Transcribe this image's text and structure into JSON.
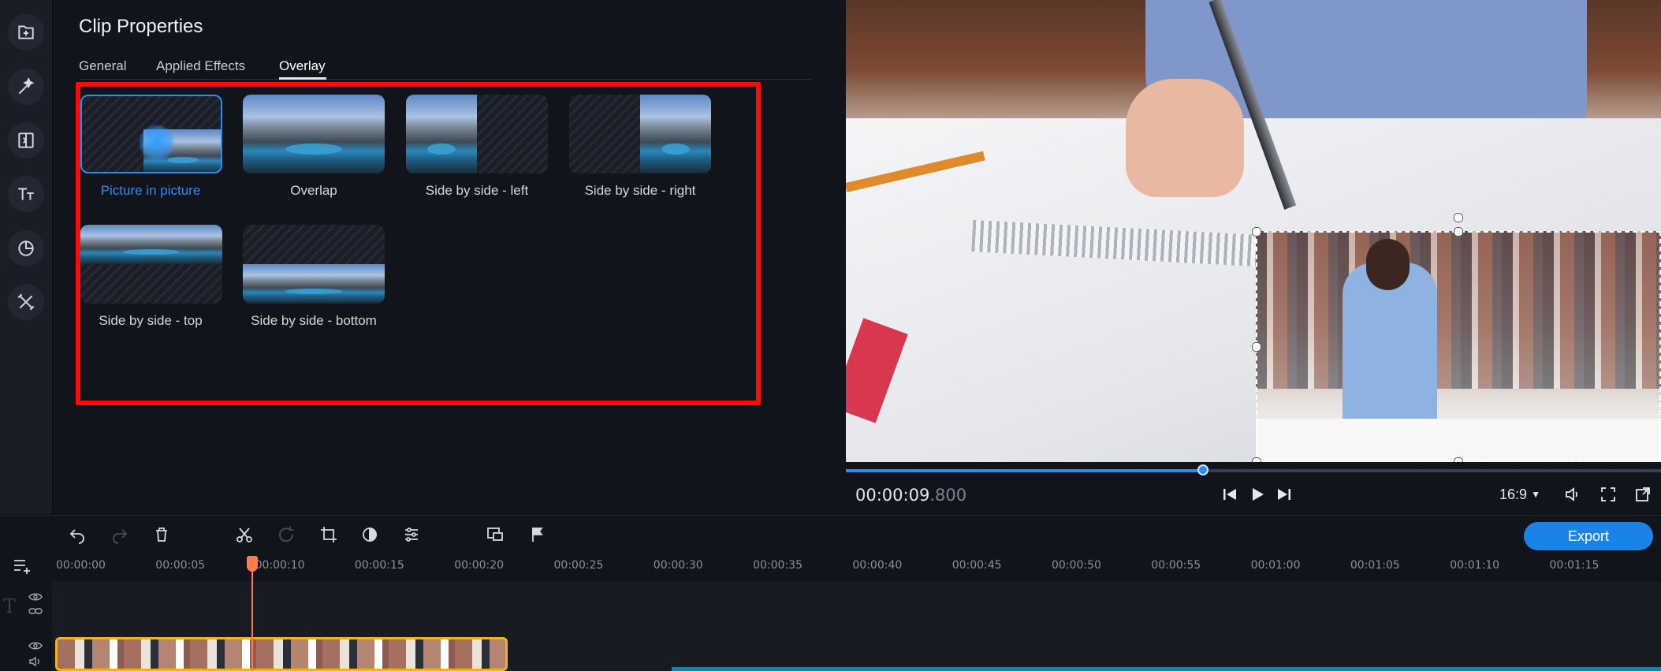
{
  "rail": {
    "items": [
      {
        "name": "import-icon"
      },
      {
        "name": "filters-icon"
      },
      {
        "name": "transitions-icon"
      },
      {
        "name": "titles-icon"
      },
      {
        "name": "stickers-icon"
      },
      {
        "name": "more-tools-icon"
      }
    ]
  },
  "panel": {
    "title": "Clip Properties",
    "tabs": [
      {
        "label": "General",
        "active": false
      },
      {
        "label": "Applied Effects",
        "active": false
      },
      {
        "label": "Overlay",
        "active": true
      }
    ],
    "overlay_options": [
      {
        "label": "Picture in picture",
        "selected": true
      },
      {
        "label": "Overlap",
        "selected": false
      },
      {
        "label": "Side by side - left",
        "selected": false
      },
      {
        "label": "Side by side - right",
        "selected": false
      },
      {
        "label": "Side by side - top",
        "selected": false
      },
      {
        "label": "Side by side - bottom",
        "selected": false
      }
    ]
  },
  "player": {
    "timecode_main": "00:00:09",
    "timecode_ms": ".800",
    "progress": 0.44,
    "aspect_ratio": "16:9"
  },
  "toolbar": {
    "export_label": "Export"
  },
  "timeline": {
    "ticks": [
      "00:00:00",
      "00:00:05",
      "00:00:10",
      "00:00:15",
      "00:00:20",
      "00:00:25",
      "00:00:30",
      "00:00:35",
      "00:00:40",
      "00:00:45",
      "00:00:50",
      "00:00:55",
      "00:01:00",
      "00:01:05",
      "00:01:10",
      "00:01:15"
    ]
  },
  "colors": {
    "accent": "#2b8df0",
    "highlight_box": "#ff0b0b",
    "playhead": "#ff7c4d",
    "clip_border": "#f2b21f"
  }
}
